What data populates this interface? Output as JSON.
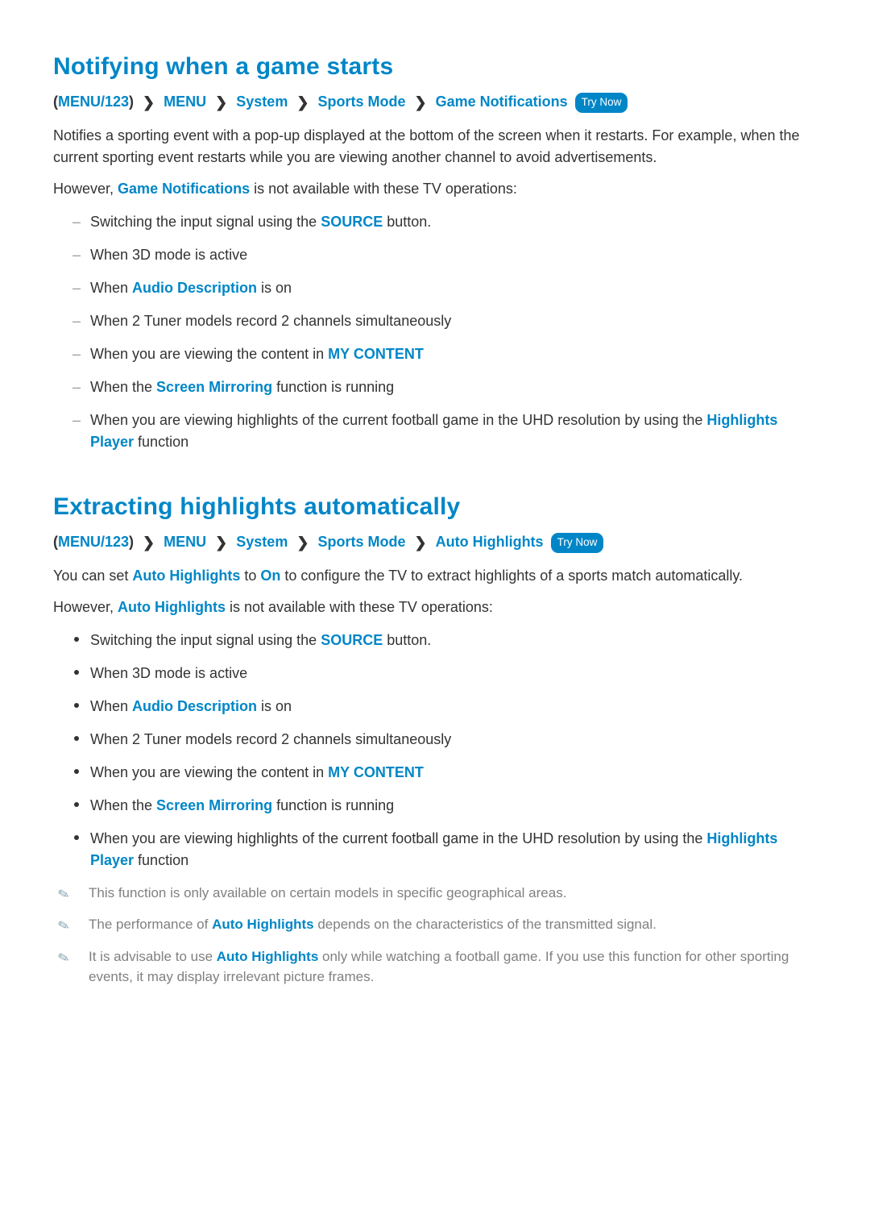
{
  "section1": {
    "title": "Notifying when a game starts",
    "breadcrumb": {
      "open": "(",
      "item0": "MENU/123",
      "close": ")",
      "item1": "MENU",
      "item2": "System",
      "item3": "Sports Mode",
      "item4": "Game Notifications",
      "try_now": "Try Now"
    },
    "para1": "Notifies a sporting event with a pop-up displayed at the bottom of the screen when it restarts. For example, when the current sporting event restarts while you are viewing another channel to avoid advertisements.",
    "para2_a": "However, ",
    "para2_hl": "Game Notifications",
    "para2_b": " is not available with these TV operations:",
    "list": {
      "i0_a": "Switching the input signal using the ",
      "i0_hl": "SOURCE",
      "i0_b": " button.",
      "i1": "When 3D mode is active",
      "i2_a": "When ",
      "i2_hl": "Audio Description",
      "i2_b": " is on",
      "i3": "When 2 Tuner models record 2 channels simultaneously",
      "i4_a": "When you are viewing the content in ",
      "i4_hl": "MY CONTENT",
      "i5_a": "When the ",
      "i5_hl": "Screen Mirroring",
      "i5_b": " function is running",
      "i6_a": "When you are viewing highlights of the current football game in the UHD resolution by using the ",
      "i6_hl": "Highlights Player",
      "i6_b": " function"
    }
  },
  "section2": {
    "title": "Extracting highlights automatically",
    "breadcrumb": {
      "open": "(",
      "item0": "MENU/123",
      "close": ")",
      "item1": "MENU",
      "item2": "System",
      "item3": "Sports Mode",
      "item4": "Auto Highlights",
      "try_now": "Try Now"
    },
    "para1_a": "You can set ",
    "para1_hl1": "Auto Highlights",
    "para1_b": " to ",
    "para1_hl2": "On",
    "para1_c": " to configure the TV to extract highlights of a sports match automatically.",
    "para2_a": "However, ",
    "para2_hl": "Auto Highlights",
    "para2_b": " is not available with these TV operations:",
    "list": {
      "i0_a": "Switching the input signal using the ",
      "i0_hl": "SOURCE",
      "i0_b": " button.",
      "i1": "When 3D mode is active",
      "i2_a": "When ",
      "i2_hl": "Audio Description",
      "i2_b": " is on",
      "i3": "When 2 Tuner models record 2 channels simultaneously",
      "i4_a": "When you are viewing the content in ",
      "i4_hl": "MY CONTENT",
      "i5_a": "When the ",
      "i5_hl": "Screen Mirroring",
      "i5_b": " function is running",
      "i6_a": "When you are viewing highlights of the current football game in the UHD resolution by using the ",
      "i6_hl": "Highlights Player",
      "i6_b": " function"
    },
    "notes": {
      "n0": "This function is only available on certain models in specific geographical areas.",
      "n1_a": "The performance of ",
      "n1_hl": "Auto Highlights",
      "n1_b": " depends on the characteristics of the transmitted signal.",
      "n2_a": "It is advisable to use ",
      "n2_hl": "Auto Highlights",
      "n2_b": " only while watching a football game. If you use this function for other sporting events, it may display irrelevant picture frames."
    }
  },
  "glyphs": {
    "chevron": "❯",
    "pencil": "✎"
  }
}
